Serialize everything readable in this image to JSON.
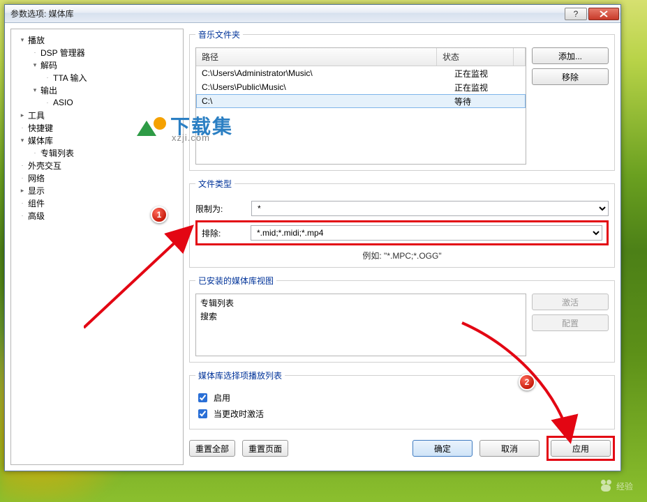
{
  "window": {
    "title": "参数选项: 媒体库"
  },
  "tree": [
    {
      "indent": 0,
      "toggle": "▾",
      "label": "播放"
    },
    {
      "indent": 1,
      "toggle": "·",
      "label": "DSP 管理器"
    },
    {
      "indent": 1,
      "toggle": "▾",
      "label": "解码"
    },
    {
      "indent": 2,
      "toggle": "·",
      "label": "TTA 输入"
    },
    {
      "indent": 1,
      "toggle": "▾",
      "label": "输出"
    },
    {
      "indent": 2,
      "toggle": "·",
      "label": "ASIO"
    },
    {
      "indent": 0,
      "toggle": "▸",
      "label": "工具"
    },
    {
      "indent": 0,
      "toggle": "·",
      "label": "快捷键"
    },
    {
      "indent": 0,
      "toggle": "▾",
      "label": "媒体库"
    },
    {
      "indent": 1,
      "toggle": "·",
      "label": "专辑列表"
    },
    {
      "indent": 0,
      "toggle": "·",
      "label": "外壳交互"
    },
    {
      "indent": 0,
      "toggle": "·",
      "label": "网络"
    },
    {
      "indent": 0,
      "toggle": "▸",
      "label": "显示"
    },
    {
      "indent": 0,
      "toggle": "·",
      "label": "组件"
    },
    {
      "indent": 0,
      "toggle": "·",
      "label": "高级"
    }
  ],
  "sections": {
    "folders": {
      "legend": "音乐文件夹",
      "head_path": "路径",
      "head_status": "状态",
      "rows": [
        {
          "path": "C:\\Users\\Administrator\\Music\\",
          "status": "正在监视",
          "sel": false
        },
        {
          "path": "C:\\Users\\Public\\Music\\",
          "status": "正在监视",
          "sel": false
        },
        {
          "path": "C:\\",
          "status": "等待",
          "sel": true
        }
      ],
      "btn_add": "添加...",
      "btn_remove": "移除"
    },
    "filetype": {
      "legend": "文件类型",
      "restrict_label": "限制为:",
      "restrict_value": "*",
      "exclude_label": "排除:",
      "exclude_value": "*.mid;*.midi;*.mp4",
      "hint": "例如: \"*.MPC;*.OGG\""
    },
    "views": {
      "legend": "已安装的媒体库视图",
      "items": [
        "专辑列表",
        "搜索"
      ],
      "btn_activate": "激活",
      "btn_config": "配置"
    },
    "playlist": {
      "legend": "媒体库选择项播放列表",
      "chk_enable": "启用",
      "chk_activate": "当更改时激活"
    }
  },
  "footer": {
    "reset_all": "重置全部",
    "reset_page": "重置页面",
    "ok": "确定",
    "cancel": "取消",
    "apply": "应用"
  },
  "annotations": {
    "one": "1",
    "two": "2"
  },
  "watermark": {
    "big": "下载集",
    "small": "xzji.com",
    "baidu": "经验"
  }
}
